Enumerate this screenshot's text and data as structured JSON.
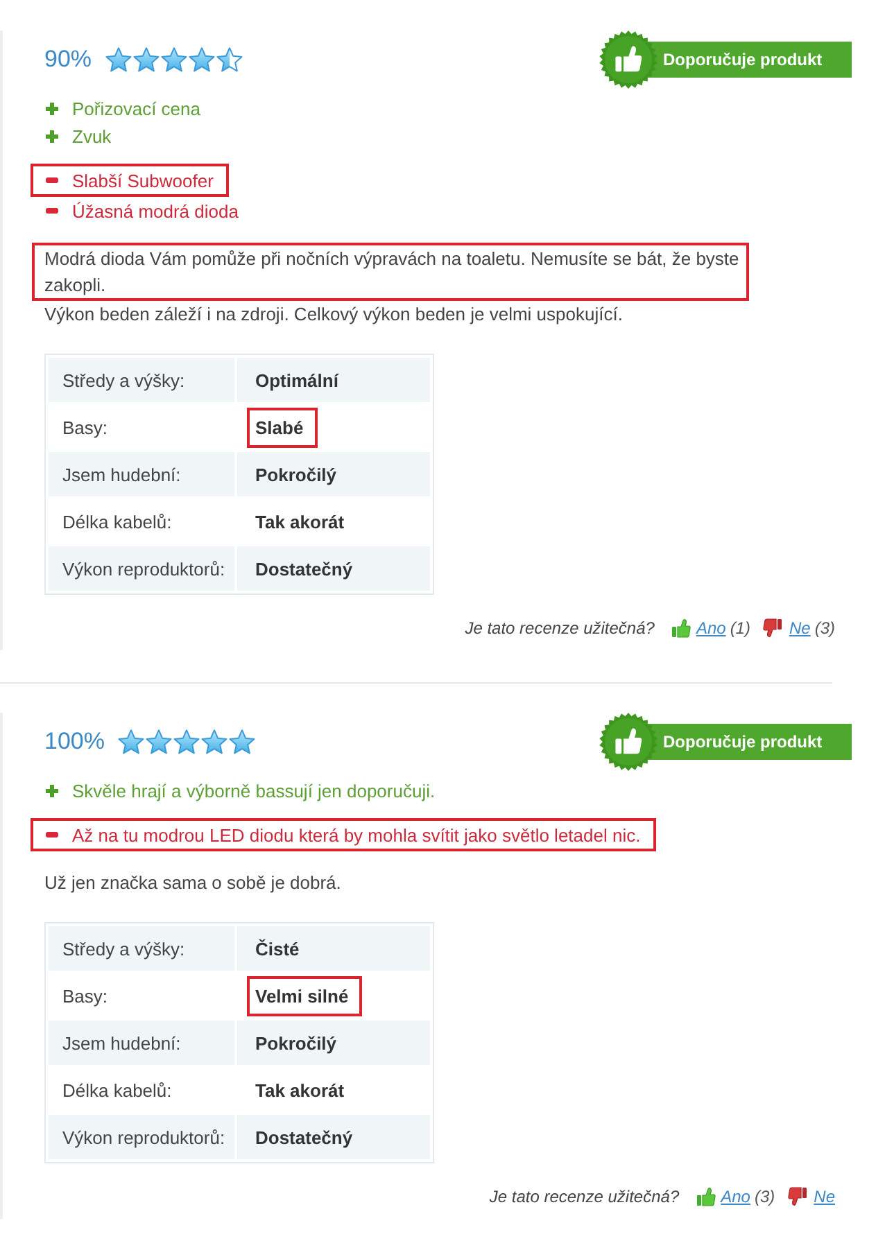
{
  "reviews": [
    {
      "rating": {
        "percent": "90%",
        "stars": 4.5
      },
      "badge": {
        "label": "Doporučuje produkt"
      },
      "pros": [
        "Pořizovací cena",
        "Zvuk"
      ],
      "cons": [
        {
          "text": "Slabší Subwoofer",
          "highlighted": true
        },
        {
          "text": "Úžasná modrá dioda",
          "highlighted": false
        }
      ],
      "body": [
        {
          "text": "Modrá dioda Vám pomůže při nočních výpravách na toaletu. Nemusíte se bát, že byste zakopli.",
          "highlighted": true
        },
        {
          "text": "Výkon beden záleží i na zdroji. Celkový výkon beden je velmi uspokující.",
          "highlighted": false
        }
      ],
      "table": {
        "rows": [
          {
            "label": "Středy a výšky:",
            "value": "Optimální",
            "highlighted": false
          },
          {
            "label": "Basy:",
            "value": "Slabé",
            "highlighted": true
          },
          {
            "label": "Jsem hudební:",
            "value": "Pokročilý",
            "highlighted": false
          },
          {
            "label": "Délka kabelů:",
            "value": "Tak akorát",
            "highlighted": false
          },
          {
            "label": "Výkon reproduktorů:",
            "value": "Dostatečný",
            "highlighted": false
          }
        ]
      },
      "helpful": {
        "question": "Je tato recenze užitečná?",
        "yes": {
          "label": "Ano",
          "count": "(1)"
        },
        "no": {
          "label": "Ne",
          "count": "(3)"
        }
      }
    },
    {
      "rating": {
        "percent": "100%",
        "stars": 5
      },
      "badge": {
        "label": "Doporučuje produkt"
      },
      "pros": [
        "Skvěle hrají a výborně bassují jen doporučuji."
      ],
      "cons": [
        {
          "text": "Až na tu modrou LED diodu která by mohla svítit jako světlo letadel nic.",
          "highlighted": true
        }
      ],
      "body": [
        {
          "text": "Už jen značka sama o sobě je dobrá.",
          "highlighted": false
        }
      ],
      "table": {
        "rows": [
          {
            "label": "Středy a výšky:",
            "value": "Čisté",
            "highlighted": false
          },
          {
            "label": "Basy:",
            "value": "Velmi silné",
            "highlighted": true
          },
          {
            "label": "Jsem hudební:",
            "value": "Pokročilý",
            "highlighted": false
          },
          {
            "label": "Délka kabelů:",
            "value": "Tak akorát",
            "highlighted": false
          },
          {
            "label": "Výkon reproduktorů:",
            "value": "Dostatečný",
            "highlighted": false
          }
        ]
      },
      "helpful": {
        "question": "Je tato recenze užitečná?",
        "yes": {
          "label": "Ano",
          "count": "(3)"
        },
        "no": {
          "label": "Ne"
        }
      }
    }
  ]
}
